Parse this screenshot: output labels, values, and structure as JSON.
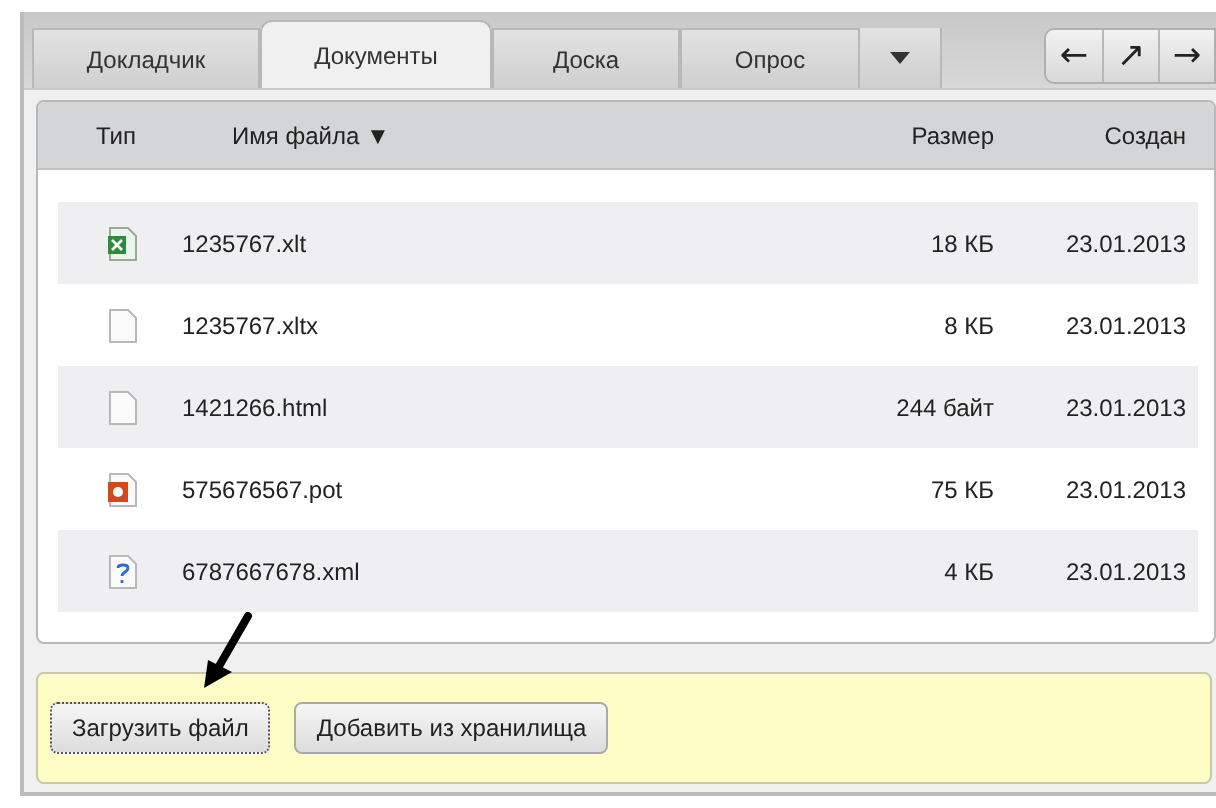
{
  "tabs": [
    {
      "label": "Докладчик",
      "selected": false
    },
    {
      "label": "Документы",
      "selected": true
    },
    {
      "label": "Доска",
      "selected": false
    },
    {
      "label": "Опрос",
      "selected": false
    }
  ],
  "nav_buttons": [
    "←",
    "↗",
    "→"
  ],
  "table": {
    "columns": [
      "Тип",
      "Имя файла ▼",
      "Размер",
      "Создан"
    ],
    "rows": [
      {
        "kind": "spreadsheet",
        "name": "1235767.xlt",
        "size": "18 КБ",
        "created": "23.01.2013"
      },
      {
        "kind": "blank",
        "name": "1235767.xltx",
        "size": "8 КБ",
        "created": "23.01.2013"
      },
      {
        "kind": "blank",
        "name": "1421266.html",
        "size": "244 байт",
        "created": "23.01.2013"
      },
      {
        "kind": "presentation",
        "name": "575676567.pot",
        "size": "75 КБ",
        "created": "23.01.2013"
      },
      {
        "kind": "unknown",
        "name": "6787667678.xml",
        "size": "4 КБ",
        "created": "23.01.2013"
      }
    ]
  },
  "footer_buttons": [
    {
      "label": "Загрузить файл",
      "focused": true
    },
    {
      "label": "Добавить из хранилища",
      "focused": false
    }
  ]
}
